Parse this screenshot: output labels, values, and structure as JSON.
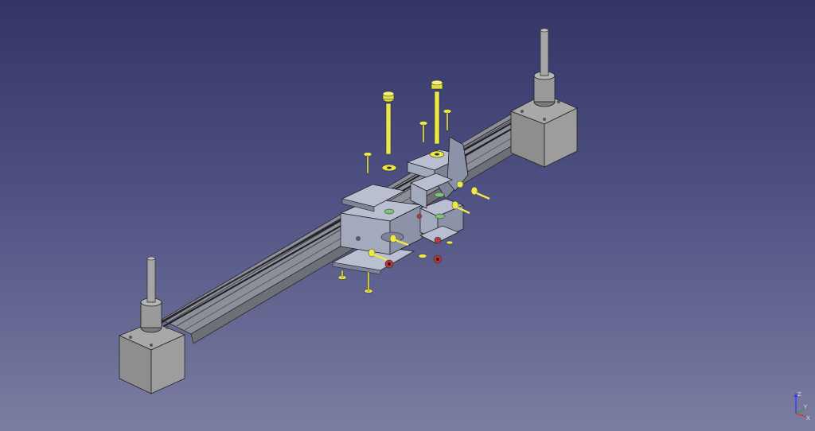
{
  "app": {
    "view": "3D viewport"
  },
  "colors": {
    "background_top": "#333567",
    "background_bottom": "#7b7da1",
    "part_face": "#a4aabe",
    "part_top": "#b9bed0",
    "part_dark": "#7d8398",
    "rail": "#8a8c96",
    "motor_box": "#9c9c9c",
    "screw": "#ece84a",
    "nut": "#b23a3a",
    "belt": "#1e1e22"
  },
  "axis_indicator": {
    "z_label": "Z",
    "y_label": "Y",
    "x_label": "X",
    "z_color": "#3a3aff",
    "y_color": "#2ea02e",
    "x_color": "#e03030"
  }
}
